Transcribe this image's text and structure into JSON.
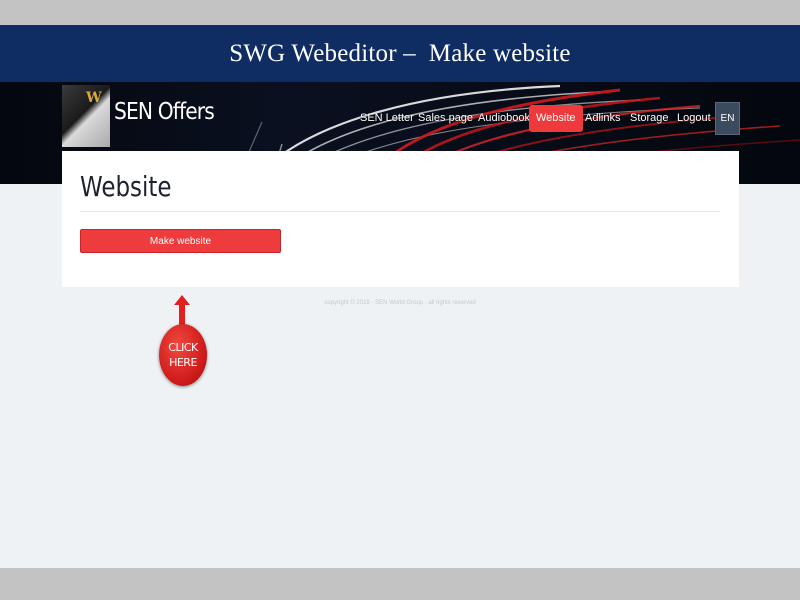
{
  "slide": {
    "title": "SWG Webeditor –  Make website"
  },
  "header": {
    "brand": "SEN Offers",
    "nav": [
      {
        "label": "SEN Letter",
        "active": false
      },
      {
        "label": "Sales page",
        "active": false
      },
      {
        "label": "Audiobook",
        "active": false
      },
      {
        "label": "Website",
        "active": true
      },
      {
        "label": "Adlinks",
        "active": false
      },
      {
        "label": "Storage",
        "active": false
      },
      {
        "label": "Logout",
        "active": false
      }
    ],
    "language": "EN"
  },
  "main": {
    "heading": "Website",
    "make_button": "Make website"
  },
  "footer": {
    "copyright": "copyright © 2019 - SEN World Group - all rights reserved"
  },
  "callout": {
    "line1": "CLICK",
    "line2": "HERE"
  },
  "colors": {
    "title_bar": "#0f2d63",
    "accent_red": "#ee3a3c",
    "page_bg": "#eff2f4"
  }
}
